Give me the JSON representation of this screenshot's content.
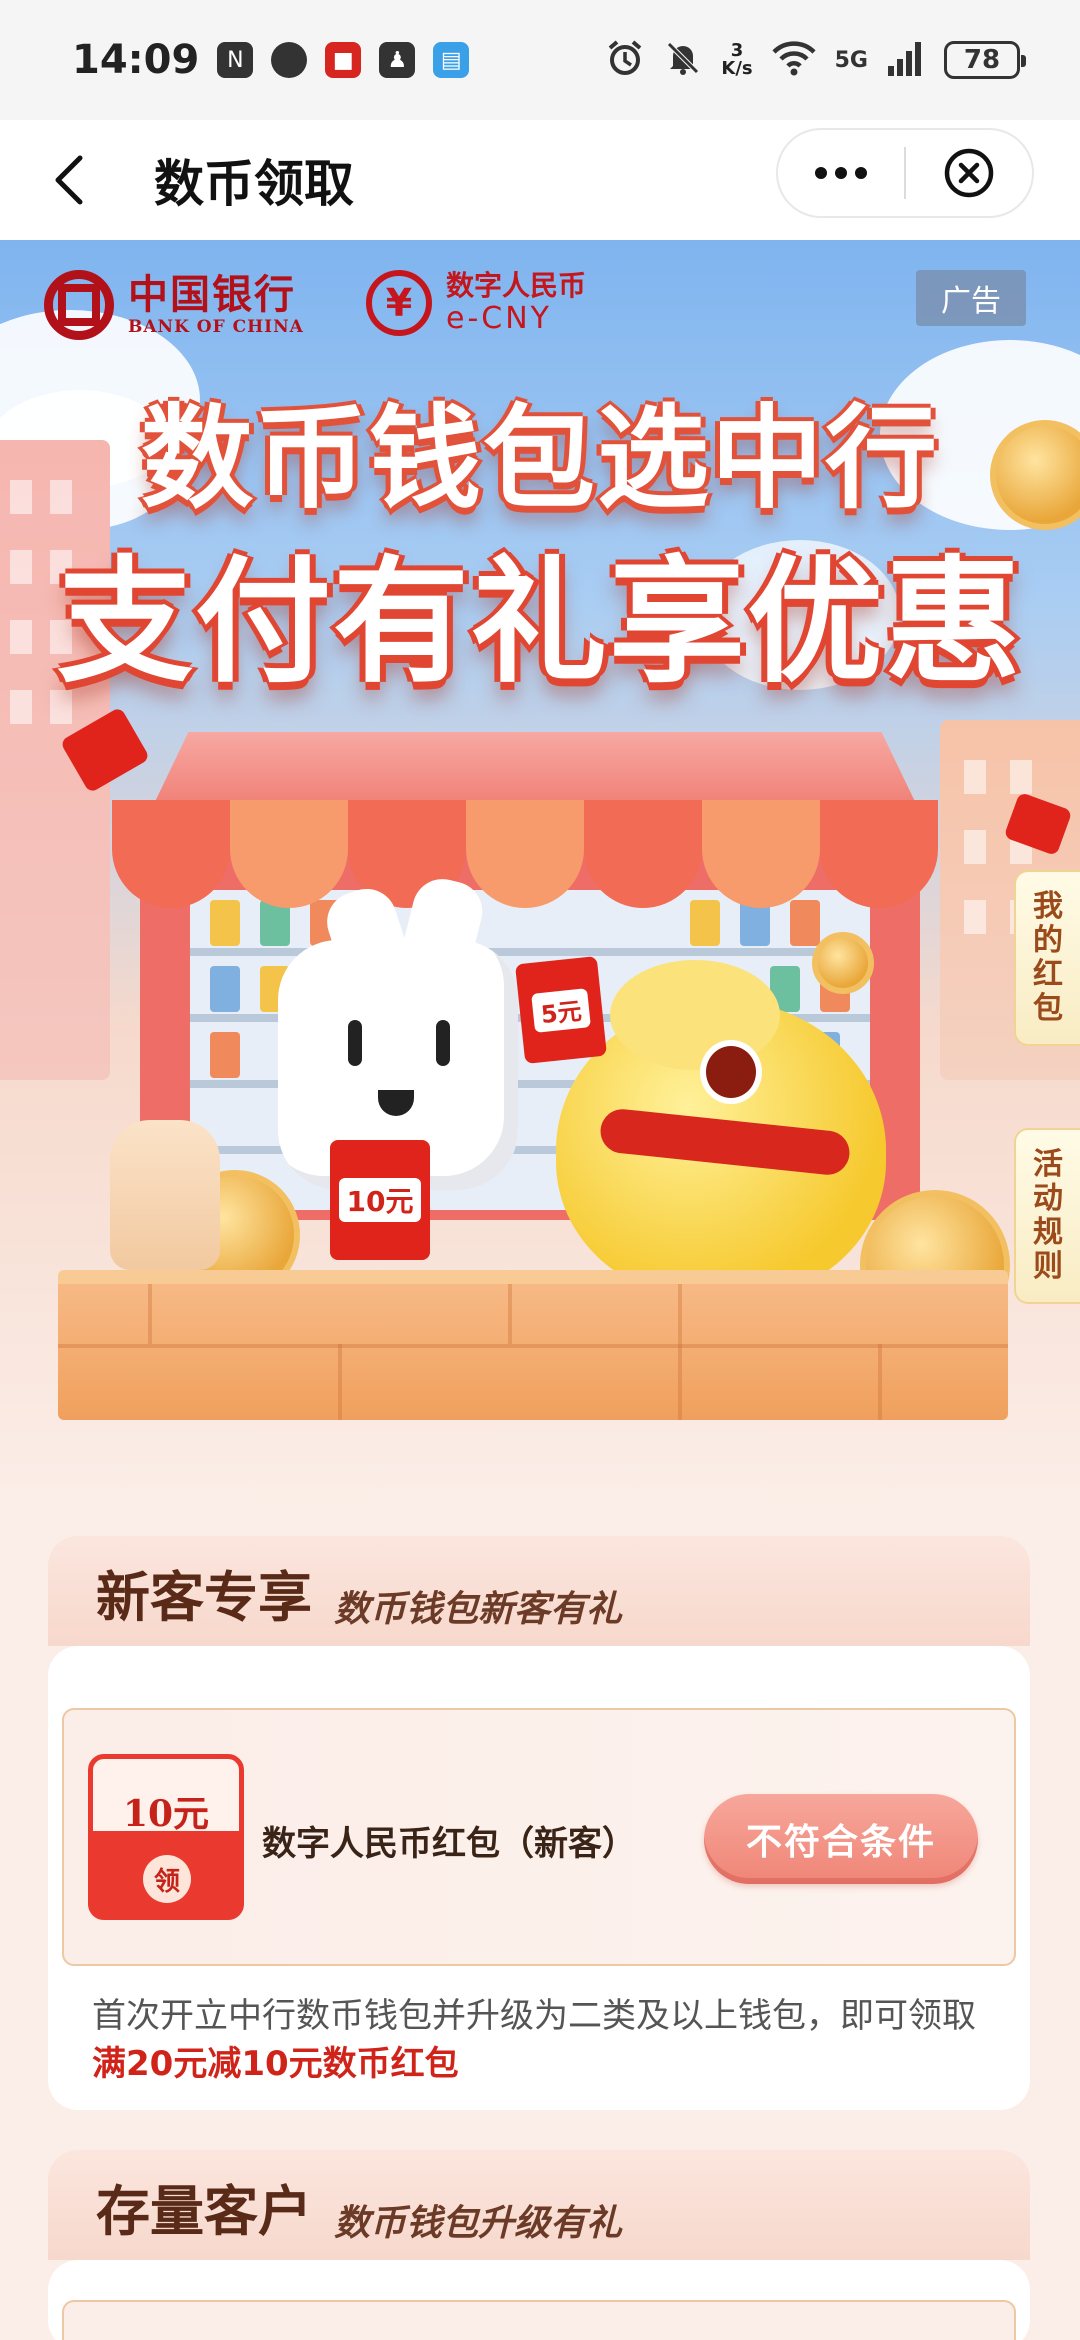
{
  "status_bar": {
    "time": "14:09",
    "left_icons": [
      "nfc-icon",
      "chat-bubble-icon",
      "app-notification-icon",
      "qq-icon",
      "reader-icon"
    ],
    "speed_value": "3",
    "speed_unit": "K/s",
    "network": "5G",
    "battery": "78"
  },
  "nav": {
    "title": "数币领取"
  },
  "banner": {
    "boc_cn": "中国银行",
    "boc_en": "BANK OF CHINA",
    "ecny_cn": "数字人民币",
    "ecny_en": "e-CNY",
    "ecny_symbol": "¥",
    "ad_label": "广告",
    "headline_line1": "数币钱包选中行",
    "headline_line2": "支付有礼享优惠",
    "packet_small": "5元",
    "packet_big": "10元",
    "side_tabs": [
      "我的红包",
      "活动规则"
    ],
    "colors": {
      "brand_red": "#b3111a",
      "headline_stroke": "#e04632"
    }
  },
  "new_customer": {
    "title": "新客专享",
    "subtitle": "数币钱包新客有礼",
    "coupon": {
      "amount": "10元",
      "seal": "领",
      "name": "数字人民币红包（新客）",
      "button": "不符合条件"
    },
    "desc_prefix": "首次开立中行数币钱包并升级为二类及以上钱包，即可领取",
    "desc_highlight": "满20元减10元数币红包"
  },
  "existing_customer": {
    "title": "存量客户",
    "subtitle": "数币钱包升级有礼"
  }
}
